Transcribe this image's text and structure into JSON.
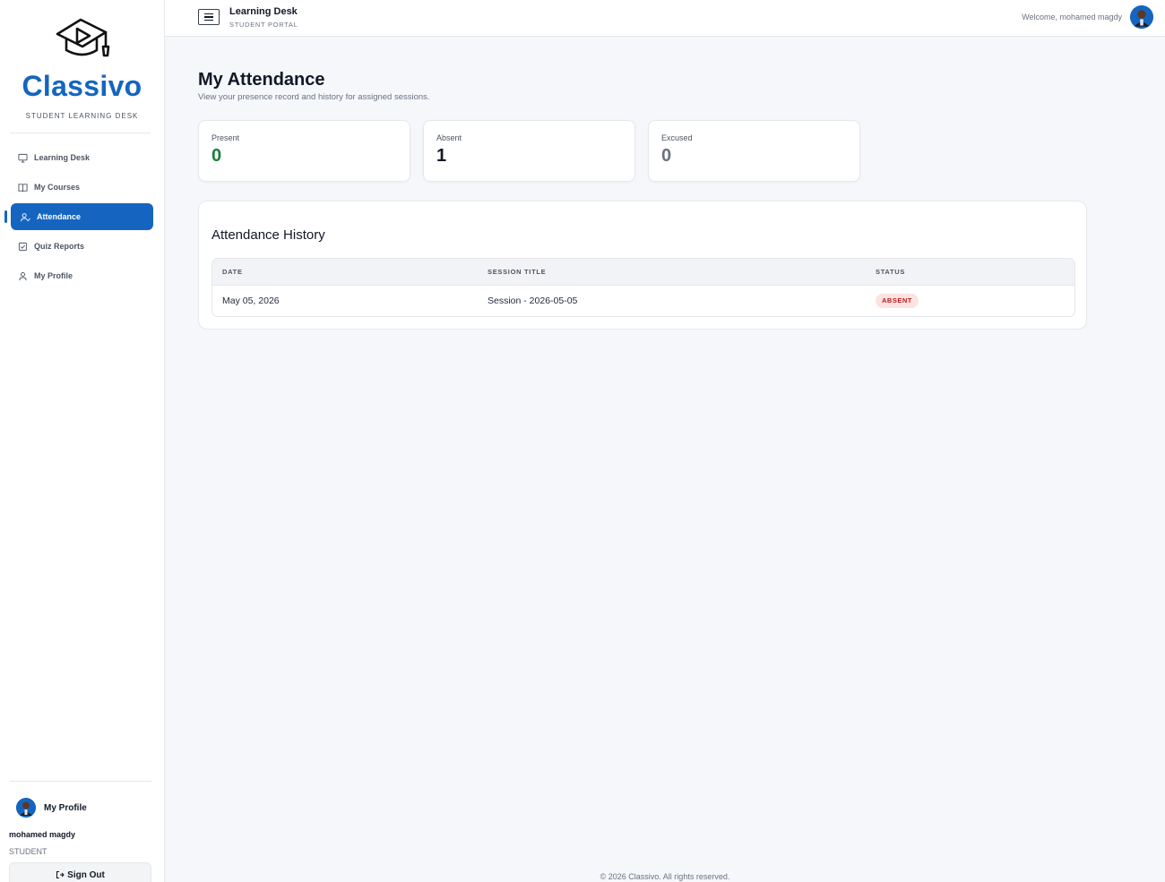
{
  "sidebar": {
    "brand": "Classivo",
    "brand_sub": "STUDENT LEARNING DESK",
    "items": [
      {
        "label": "Learning Desk",
        "icon": "monitor-icon"
      },
      {
        "label": "My Courses",
        "icon": "book-icon"
      },
      {
        "label": "Attendance",
        "icon": "user-check-icon",
        "active": true
      },
      {
        "label": "Quiz Reports",
        "icon": "checklist-icon"
      },
      {
        "label": "My Profile",
        "icon": "user-icon"
      }
    ],
    "profile_link": "My Profile",
    "user_name": "mohamed magdy",
    "user_role": "STUDENT",
    "signout": "Sign Out"
  },
  "topbar": {
    "title": "Learning Desk",
    "subtitle": "STUDENT PORTAL",
    "welcome": "Welcome, mohamed magdy"
  },
  "main": {
    "title": "My Attendance",
    "subtitle": "View your presence record and history for assigned sessions.",
    "stats": [
      {
        "label": "Present",
        "value": "0",
        "color": "#15803d"
      },
      {
        "label": "Absent",
        "value": "1",
        "color": "#111827"
      },
      {
        "label": "Excused",
        "value": "0",
        "color": "#6b7280"
      }
    ],
    "history": {
      "title": "Attendance History",
      "columns": [
        "DATE",
        "SESSION TITLE",
        "STATUS"
      ],
      "rows": [
        {
          "date": "May 05, 2026",
          "session": "Session - 2026-05-05",
          "status": "ABSENT"
        }
      ]
    }
  },
  "footer": "© 2026 Classivo. All rights reserved.",
  "colors": {
    "accent": "#1565c0",
    "absent_bg": "#fde2e2",
    "absent_text": "#b91c1c"
  }
}
